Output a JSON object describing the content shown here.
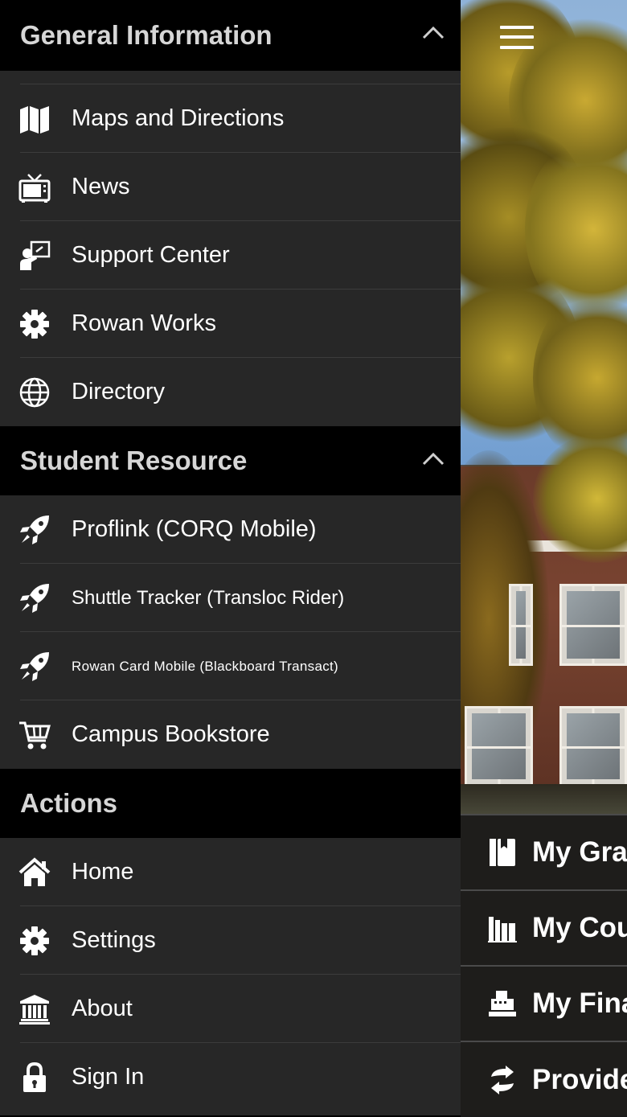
{
  "drawer": {
    "sections": [
      {
        "title": "General Information",
        "collapsible": true,
        "items": [
          {
            "label": "Maps and Directions",
            "icon": "map-icon"
          },
          {
            "label": "News",
            "icon": "tv-icon"
          },
          {
            "label": "Support Center",
            "icon": "support-presenter-icon"
          },
          {
            "label": "Rowan Works",
            "icon": "gear-icon"
          },
          {
            "label": "Directory",
            "icon": "globe-icon"
          }
        ]
      },
      {
        "title": "Student Resource",
        "collapsible": true,
        "items": [
          {
            "label": "Proflink (CORQ Mobile)",
            "icon": "rocket-icon"
          },
          {
            "label": "Shuttle Tracker (Transloc Rider)",
            "icon": "rocket-icon"
          },
          {
            "label": "Rowan Card Mobile (Blackboard Transact)",
            "icon": "rocket-icon"
          },
          {
            "label": "Campus Bookstore",
            "icon": "cart-icon"
          }
        ]
      },
      {
        "title": "Actions",
        "collapsible": false,
        "items": [
          {
            "label": "Home",
            "icon": "home-icon"
          },
          {
            "label": "Settings",
            "icon": "gear-icon"
          },
          {
            "label": "About",
            "icon": "institution-icon"
          },
          {
            "label": "Sign In",
            "icon": "lock-icon"
          }
        ]
      }
    ]
  },
  "main": {
    "menu_icon": "hamburger-icon",
    "quick_links": [
      {
        "label": "My Gra",
        "icon": "book-icon"
      },
      {
        "label": "My Cou",
        "icon": "books-icon"
      },
      {
        "label": "My Fina",
        "icon": "cash-register-icon"
      },
      {
        "label": "Provide",
        "icon": "exchange-icon"
      }
    ]
  },
  "colors": {
    "drawer_bg": "#272727",
    "header_bg": "#000000",
    "header_text": "#d6d6d6",
    "item_text": "#ffffff"
  }
}
